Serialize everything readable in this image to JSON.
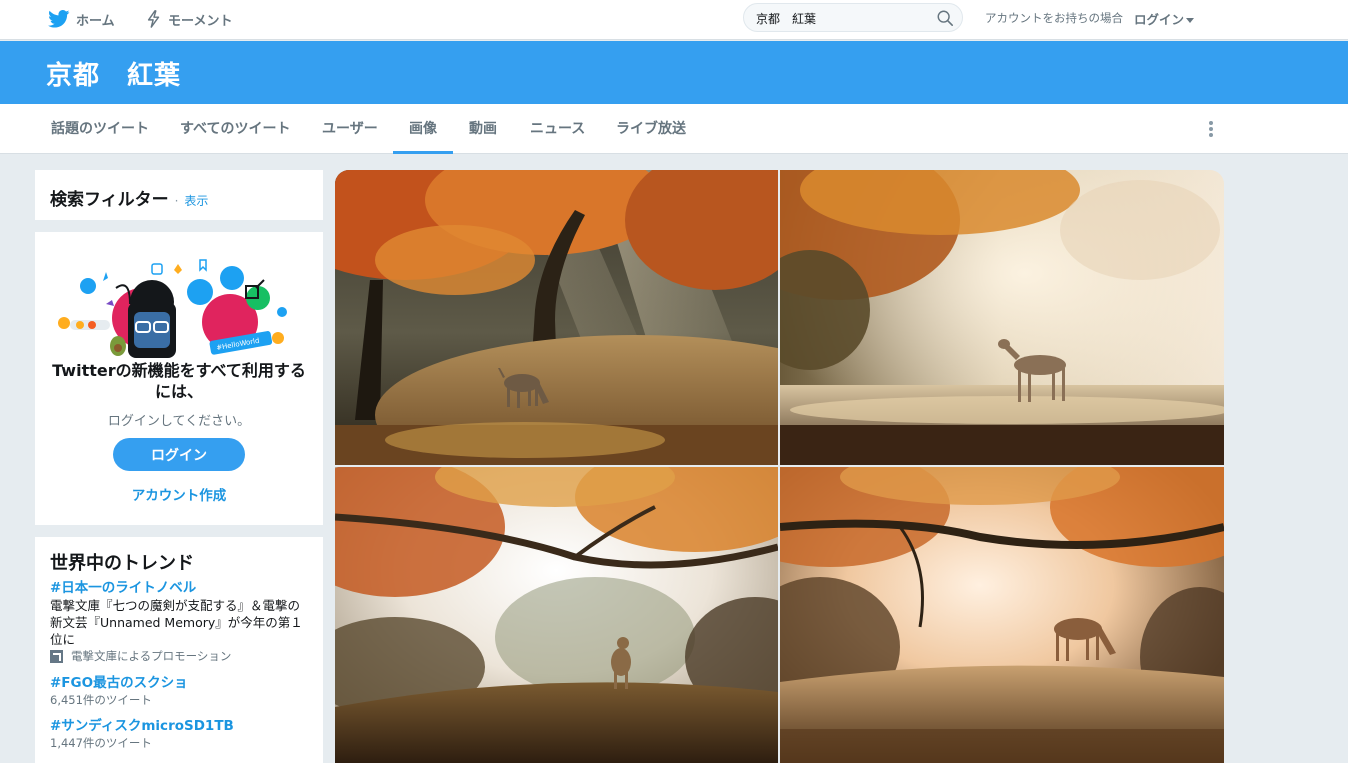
{
  "topnav": {
    "home_label": "ホーム",
    "moments_label": "モーメント",
    "search_value": "京都　紅葉",
    "account_prompt": "アカウントをお持ちの場合",
    "login_label": "ログイン"
  },
  "header": {
    "query_title": "京都　紅葉"
  },
  "tabs": [
    {
      "label": "話題のツイート"
    },
    {
      "label": "すべてのツイート"
    },
    {
      "label": "ユーザー"
    },
    {
      "label": "画像"
    },
    {
      "label": "動画"
    },
    {
      "label": "ニュース"
    },
    {
      "label": "ライブ放送"
    }
  ],
  "active_tab": "画像",
  "filter": {
    "title": "検索フィルター",
    "separator": "·",
    "show_label": "表示"
  },
  "promo": {
    "heading": "Twitterの新機能をすべて利用するには、",
    "subtext": "ログインしてください。",
    "login_button": "ログイン",
    "signup_link": "アカウント作成",
    "art_badge_text": "#HelloWorld"
  },
  "trends": {
    "title": "世界中のトレンド",
    "items": [
      {
        "tag": "#日本一のライトノベル",
        "desc": "電撃文庫『七つの魔剣が支配する』＆電撃の新文芸『Unnamed Memory』が今年の第１位に",
        "meta": "電撃文庫によるプロモーション",
        "promoted": true
      },
      {
        "tag": "#FGO最古のスクショ",
        "meta": "6,451件のツイート"
      },
      {
        "tag": "#サンディスクmicroSD1TB",
        "meta": "1,447件のツイート"
      }
    ]
  },
  "colors": {
    "brand_blue": "#359ff0",
    "link_blue": "#1b95e0",
    "page_bg": "#e6ecf0"
  },
  "icons": [
    "twitter-bird-icon",
    "lightning-icon",
    "search-icon",
    "more-vertical-icon",
    "promoted-arrow-icon"
  ],
  "images": [
    {
      "subject": "deer-grazing-autumn-forest"
    },
    {
      "subject": "deer-walking-misty-sunlight"
    },
    {
      "subject": "deer-standing-under-maple"
    },
    {
      "subject": "deer-grazing-golden-light"
    }
  ]
}
